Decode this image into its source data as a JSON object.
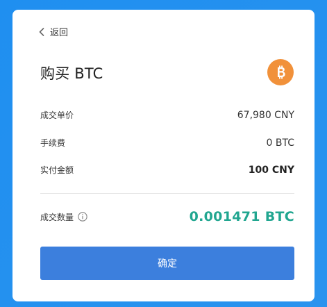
{
  "header": {
    "back_label": "返回",
    "title": "购买 BTC"
  },
  "coin": {
    "icon": "bitcoin-icon",
    "color": "#f1913a"
  },
  "details": {
    "unit_price_label": "成交单价",
    "unit_price_value": "67,980 CNY",
    "fee_label": "手续费",
    "fee_value": "0 BTC",
    "paid_label": "实付金额",
    "paid_value": "100 CNY"
  },
  "quantity": {
    "label": "成交数量",
    "info_icon": "info-icon",
    "value": "0.001471 BTC",
    "color": "#21a690"
  },
  "actions": {
    "confirm_label": "确定",
    "confirm_color": "#3c7fdd"
  }
}
